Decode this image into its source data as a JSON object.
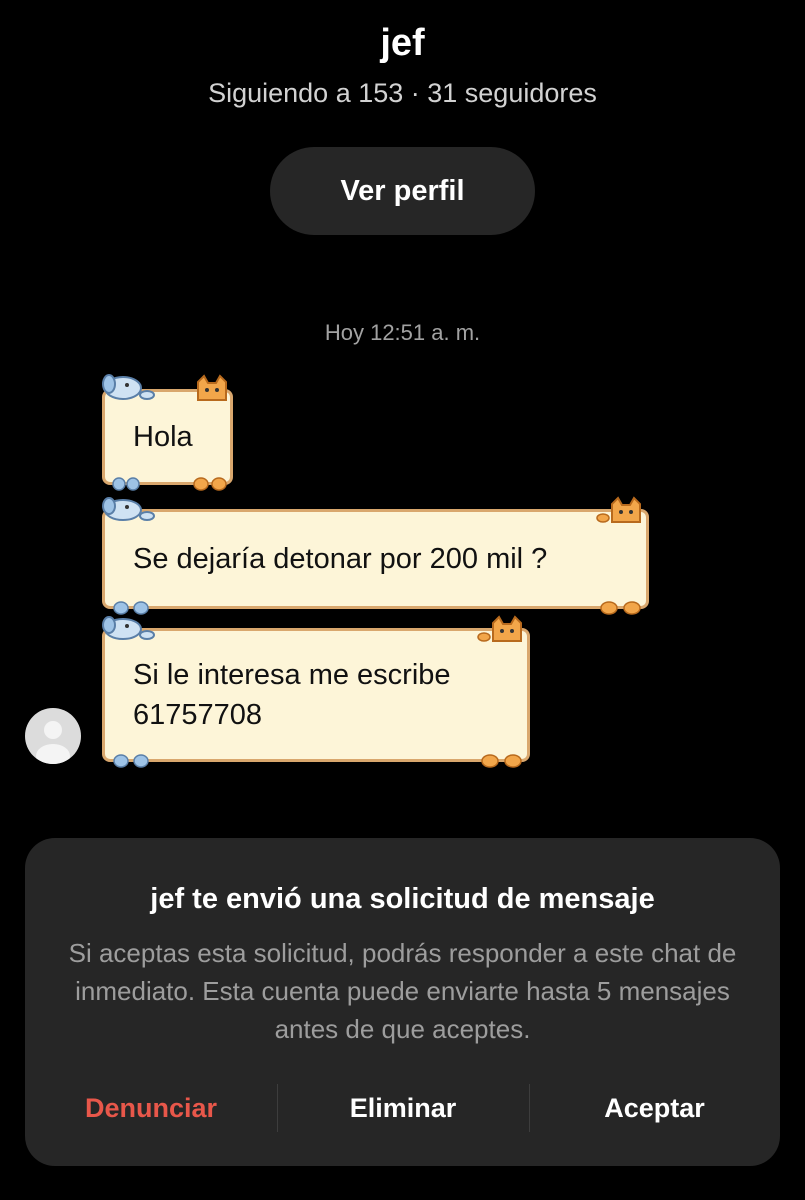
{
  "profile": {
    "name": "jef",
    "stats": "Siguiendo a 153 · 31 seguidores",
    "view_profile_label": "Ver perfil"
  },
  "chat": {
    "timestamp": "Hoy 12:51 a. m.",
    "messages": [
      {
        "text": "Hola"
      },
      {
        "text": "Se dejaría detonar por 200 mil ?"
      },
      {
        "text": "Si le interesa me escribe\n61757708"
      }
    ]
  },
  "request": {
    "title": "jef te envió una solicitud de mensaje",
    "body": "Si aceptas esta solicitud, podrás responder a este chat de inmediato. Esta cuenta puede enviarte hasta 5 mensajes antes de que aceptes.",
    "actions": {
      "report": "Denunciar",
      "delete": "Eliminar",
      "accept": "Aceptar"
    }
  },
  "colors": {
    "background": "#000000",
    "button_bg": "#262626",
    "bubble_bg": "#fdf5d8",
    "bubble_border": "#d9a76d",
    "report": "#e8574a"
  },
  "icons": {
    "avatar": "default-avatar-icon",
    "bubble_decor": [
      "dog-icon",
      "cat-icon",
      "paw-icon"
    ]
  }
}
